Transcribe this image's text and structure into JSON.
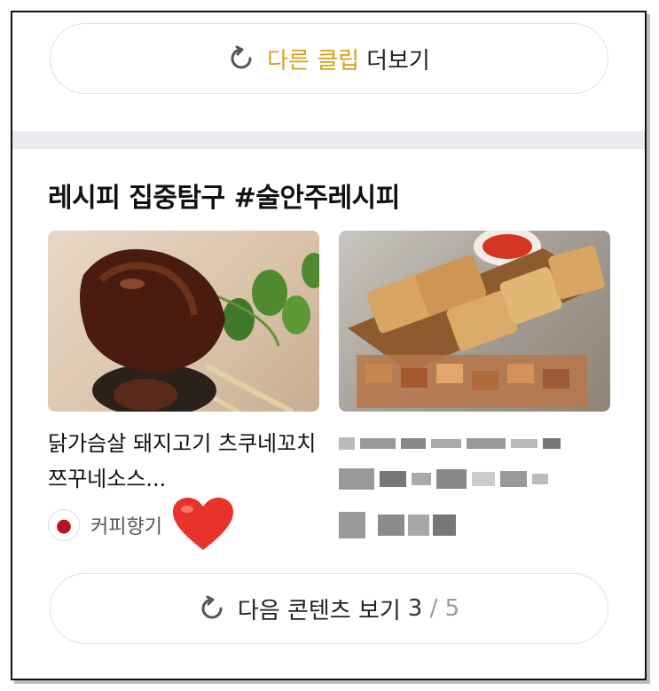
{
  "top_button": {
    "accent_label": "다른 클립",
    "label": "더보기"
  },
  "section": {
    "title": "레시피 집중탐구 #술안주레시피"
  },
  "cards": [
    {
      "title": "닭가슴살 돼지고기 츠쿠네꼬치 쯔꾸네소스...",
      "author": "커피향기"
    },
    {
      "title": "",
      "author": ""
    }
  ],
  "bottom_button": {
    "label": "다음 콘텐츠 보기",
    "current_page": "3",
    "separator": " / ",
    "total_pages": "5"
  },
  "colors": {
    "accent": "#d3a21b",
    "divider": "#e9ebee",
    "heart": "#e8332a"
  },
  "icons": {
    "refresh": "refresh-icon",
    "heart": "heart-icon"
  }
}
